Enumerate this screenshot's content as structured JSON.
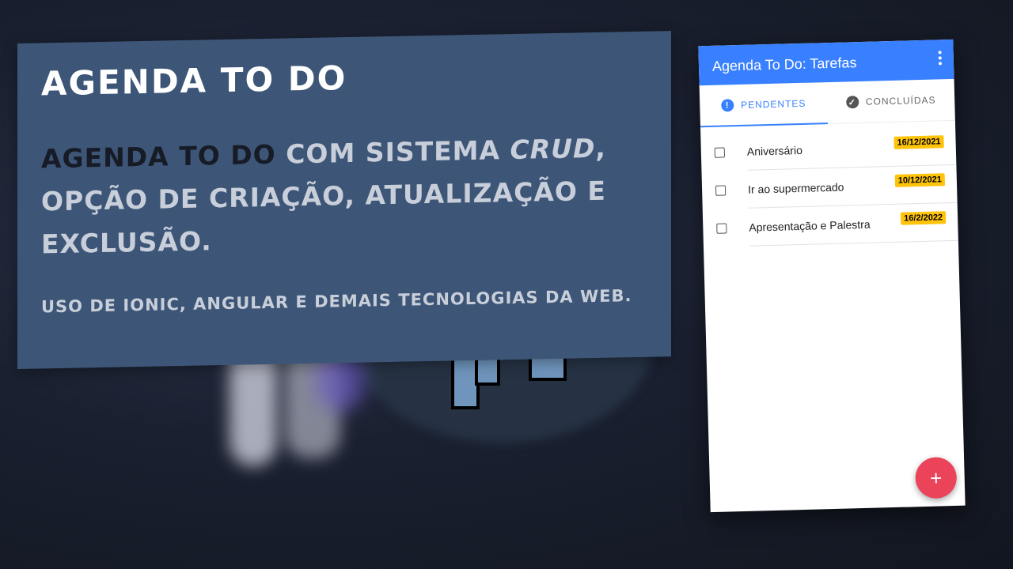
{
  "banner": {
    "title": "Agenda To Do",
    "desc_highlight": "Agenda To Do",
    "desc_part1": " com sistema ",
    "desc_italic": "CRUD",
    "desc_part2": ", opção de criação, atualização e exclusão.",
    "subtitle": "Uso de Ionic, Angular e demais tecnologias da web."
  },
  "app": {
    "title": "Agenda To Do: Tarefas",
    "menu_icon": "more-vertical-icon",
    "tabs": [
      {
        "label": "PENDENTES",
        "icon": "alert-circle-icon",
        "active": true
      },
      {
        "label": "CONCLUÍDAS",
        "icon": "checkmark-circle-icon",
        "active": false
      }
    ],
    "tasks": [
      {
        "label": "Aniversário",
        "date": "16/12/2021",
        "checked": false
      },
      {
        "label": "Ir ao supermercado",
        "date": "10/12/2021",
        "checked": false
      },
      {
        "label": "Apresentação e Palestra",
        "date": "16/2/2022",
        "checked": false
      }
    ],
    "fab_icon": "+"
  },
  "colors": {
    "primary": "#3880ff",
    "warning": "#ffc409",
    "danger": "#eb445a",
    "banner": "#3d5677"
  }
}
